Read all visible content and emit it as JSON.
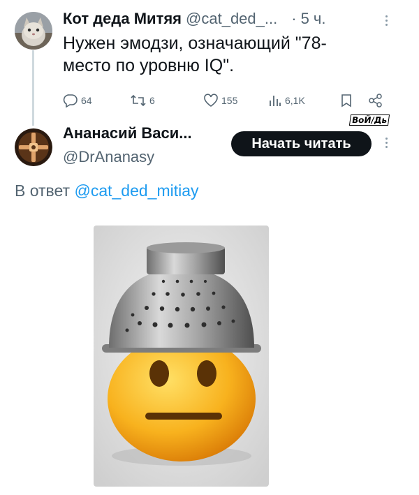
{
  "parent_tweet": {
    "author_name": "Кот деда Митяя",
    "author_handle": "@cat_ded_...",
    "separator": "·",
    "time": "5 ч.",
    "text": "Нужен эмодзи, означающий \"78-место по уровню IQ\".",
    "actions": {
      "replies": "64",
      "retweets": "6",
      "likes": "155",
      "views": "6,1K"
    }
  },
  "reply_tweet": {
    "author_name": "Ананасий Васи...",
    "author_handle": "@DrAnanasy",
    "follow_label": "Начать читать",
    "reply_prefix": "В ответ",
    "reply_to": "@cat_ded_mitiay"
  },
  "watermark": "ВоЙ/Дь",
  "icons": {
    "reply": "reply-icon",
    "retweet": "retweet-icon",
    "like": "heart-icon",
    "views": "views-icon",
    "bookmark": "bookmark-icon",
    "share": "share-icon",
    "more": "more-icon"
  },
  "colors": {
    "link": "#1d9bf0",
    "secondary_text": "#536471",
    "button_bg": "#0f1419"
  }
}
